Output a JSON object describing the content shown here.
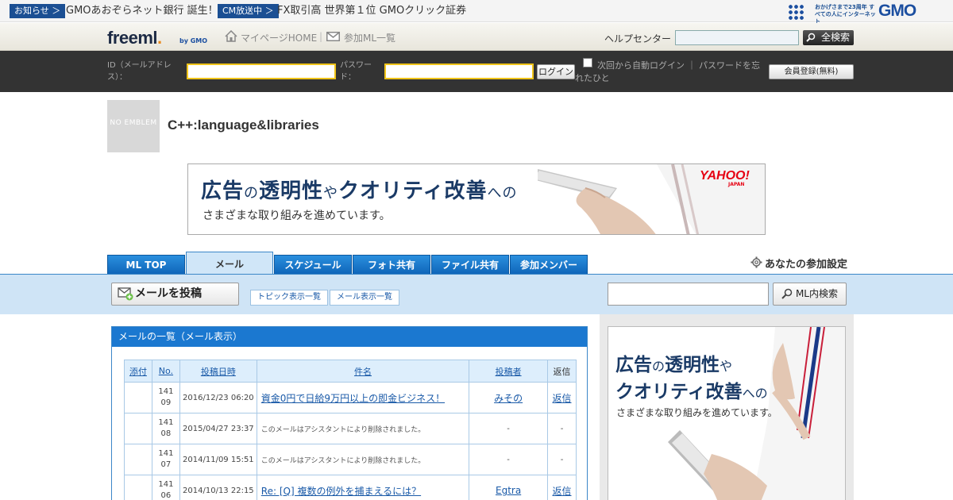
{
  "notice_bar": {
    "tag1": "お知らせ ＞",
    "text1": "GMOあおぞらネット銀行 誕生！",
    "tag2": "CM放送中 ＞",
    "text2": "FX取引高 世界第１位 GMOクリック証券",
    "gmo_tagline": "おかげさまで23周年 すべての人にインターネット",
    "gmo_logo": "GMO"
  },
  "header": {
    "logo": "freeml",
    "logo_dot": ".",
    "logo_by": "by GMO",
    "mypage_link": "マイページHOME",
    "separator": "|",
    "ml_list_link": "参加ML一覧",
    "help_label": "ヘルプセンター",
    "search_all_button": "全検索"
  },
  "login": {
    "id_label": "ID（メールアドレス）：",
    "password_label": "パスワード：",
    "login_button": "ログイン",
    "auto_login_text": "次回から自動ログイン ｜ パスワードを忘れたひと",
    "register_button": "会員登録(無料)"
  },
  "group": {
    "emblem_text": "NO EMBLEM",
    "name": "C++:language&libraries"
  },
  "ad_banner": {
    "line1_a": "広告",
    "line1_b": "の",
    "line1_c": "透明性",
    "line1_d": "や",
    "line1_e": "クオリティ改善",
    "line1_f": "への",
    "line2": "さまざまな取り組みを進めています。",
    "brand": "YAHOO!",
    "brand_sub": "JAPAN"
  },
  "tabs": [
    {
      "label": "ML TOP"
    },
    {
      "label": "メール"
    },
    {
      "label": "スケジュール"
    },
    {
      "label": "フォト共有"
    },
    {
      "label": "ファイル共有"
    },
    {
      "label": "参加メンバー"
    }
  ],
  "participation_setting": "あなたの参加設定",
  "toolbar": {
    "post_mail_button": "メールを投稿",
    "topic_view_button": "トピック表示一覧",
    "mail_view_button": "メール表示一覧",
    "ml_search_button": "ML内検索"
  },
  "mail_list": {
    "panel_title": "メールの一覧（メール表示）",
    "columns": [
      "添付",
      "No.",
      "投稿日時",
      "件名",
      "投稿者",
      "返信"
    ],
    "rows": [
      {
        "attach": "",
        "no": "14109",
        "date": "2016/12/23 06:20",
        "subject": "資金0円で日給9万円以上の即金ビジネス！",
        "author": "みその",
        "reply": "返信"
      },
      {
        "attach": "",
        "no": "14108",
        "date": "2015/04/27 23:37",
        "subject": "このメールはアシスタントにより削除されました。",
        "author": "-",
        "reply": "-"
      },
      {
        "attach": "",
        "no": "14107",
        "date": "2014/11/09 15:51",
        "subject": "このメールはアシスタントにより削除されました。",
        "author": "-",
        "reply": "-"
      },
      {
        "attach": "",
        "no": "14106",
        "date": "2014/10/13 22:15",
        "subject": "Re: [Q] 複数の例外を捕まえるには？",
        "author": "Egtra",
        "reply": "返信"
      }
    ]
  },
  "side_ad": {
    "line1_a": "広告",
    "line1_b": "の",
    "line1_c": "透明性",
    "line1_d": "や",
    "line2_a": "クオリティ改善",
    "line2_b": "への",
    "line3": "さまざまな取り組みを進めています。"
  },
  "colors": {
    "tab_blue": "#1b78d0",
    "toolbar_band": "#cfe4f6",
    "login_bar": "#333333",
    "input_highlight": "#f0c419"
  }
}
